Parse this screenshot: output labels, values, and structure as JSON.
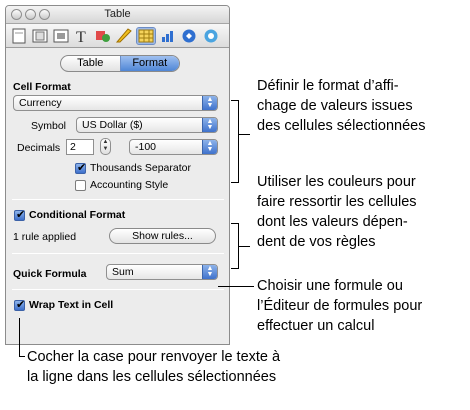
{
  "window": {
    "title": "Table",
    "toolbar_icons": [
      "document-icon",
      "layout-icon",
      "wrap-icon",
      "text-icon",
      "graphic-icon",
      "metrics-icon",
      "table-icon",
      "chart-icon",
      "link-icon",
      "quicktime-icon"
    ]
  },
  "tabs": [
    {
      "label": "Table",
      "selected": false
    },
    {
      "label": "Format",
      "selected": true
    }
  ],
  "cell_format": {
    "section_label": "Cell Format",
    "format_value": "Currency",
    "symbol_label": "Symbol",
    "symbol_value": "US Dollar ($)",
    "decimals_label": "Decimals",
    "decimals_value": "2",
    "negative_value": "-100",
    "thousands_label": "Thousands Separator",
    "thousands_checked": true,
    "accounting_label": "Accounting Style",
    "accounting_checked": false
  },
  "conditional_format": {
    "label": "Conditional Format",
    "checked": true,
    "rules_status": "1 rule applied",
    "show_rules_label": "Show rules..."
  },
  "quick_formula": {
    "label": "Quick Formula",
    "value": "Sum"
  },
  "wrap_text": {
    "label": "Wrap Text in Cell",
    "checked": true
  },
  "callouts": {
    "cell_format": [
      "Définir le format d’affi-",
      "chage de valeurs issues",
      "des cellules sélectionnées"
    ],
    "conditional": [
      "Utiliser les couleurs pour",
      "faire ressortir les cellules",
      "dont les valeurs dépen-",
      "dent de vos règles"
    ],
    "formula": [
      "Choisir une formule ou",
      "l’Éditeur de formules pour",
      "effectuer un calcul"
    ],
    "wrap": [
      "Cocher la case pour renvoyer le texte à",
      "la ligne dans les cellules sélectionnées"
    ]
  }
}
